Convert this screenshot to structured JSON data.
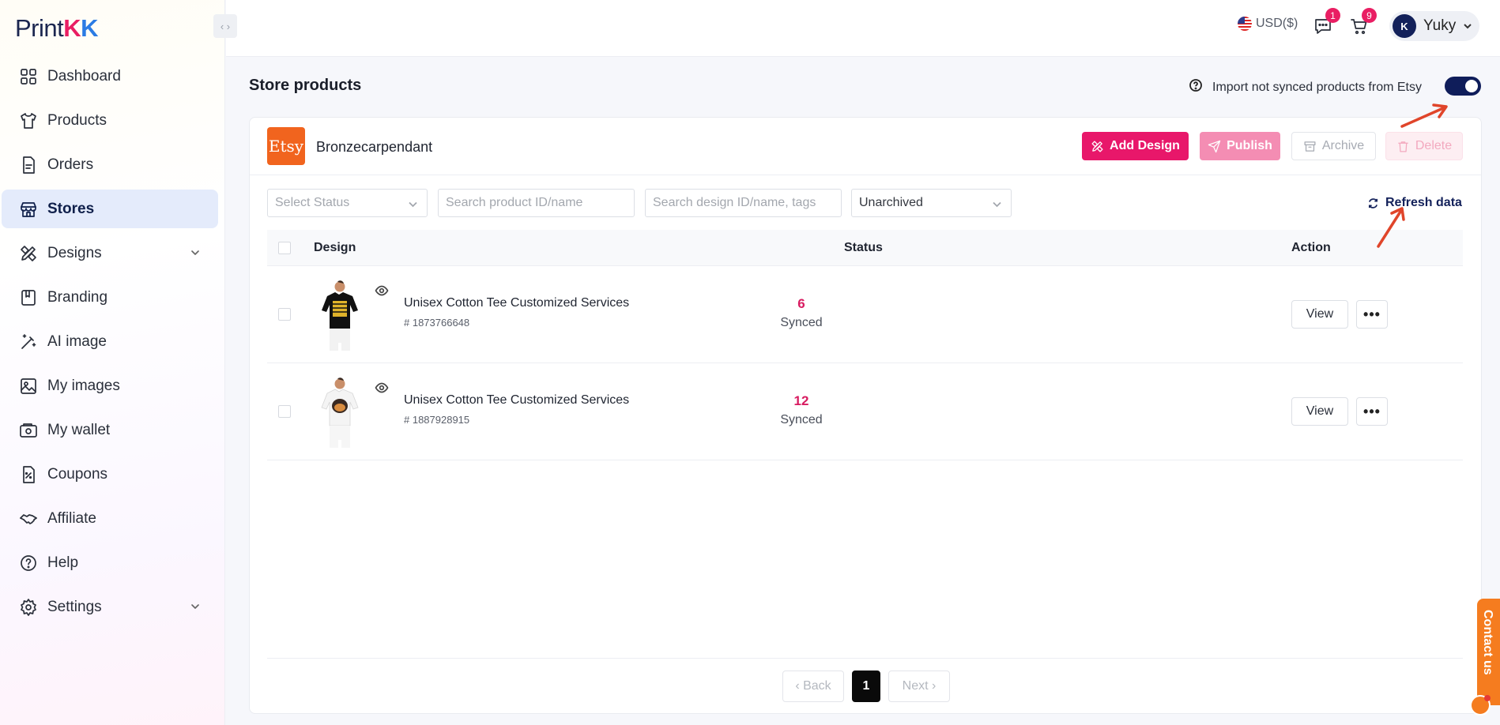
{
  "brand": {
    "prefix": "Print",
    "k1": "K",
    "k2": "K",
    "collapse": "‹ ›"
  },
  "sidebar": {
    "items": [
      {
        "label": "Dashboard",
        "icon": "grid-icon"
      },
      {
        "label": "Products",
        "icon": "tshirt-icon"
      },
      {
        "label": "Orders",
        "icon": "document-icon"
      },
      {
        "label": "Stores",
        "icon": "store-icon"
      },
      {
        "label": "Designs",
        "icon": "pencil-ruler-icon"
      },
      {
        "label": "Branding",
        "icon": "book-icon"
      },
      {
        "label": "AI image",
        "icon": "magic-wand-icon"
      },
      {
        "label": "My images",
        "icon": "image-icon"
      },
      {
        "label": "My wallet",
        "icon": "wallet-icon"
      },
      {
        "label": "Coupons",
        "icon": "coupon-icon"
      },
      {
        "label": "Affiliate",
        "icon": "handshake-icon"
      },
      {
        "label": "Help",
        "icon": "help-circle-icon"
      },
      {
        "label": "Settings",
        "icon": "gear-icon"
      }
    ],
    "active": "Stores"
  },
  "topbar": {
    "currency": "USD($)",
    "messages_count": "1",
    "cart_count": "9",
    "user": {
      "initials": "K",
      "name": "Yuky"
    }
  },
  "page": {
    "title": "Store products",
    "import_label": "Import not synced products from Etsy",
    "import_enabled": true
  },
  "store": {
    "logo_text": "Etsy",
    "name": "Bronzecarpendant",
    "logo_color": "#f1641e"
  },
  "actions": {
    "add_design": "Add Design",
    "publish": "Publish",
    "archive": "Archive",
    "delete": "Delete"
  },
  "filters": {
    "status_placeholder": "Select Status",
    "product_placeholder": "Search product ID/name",
    "design_placeholder": "Search design ID/name, tags",
    "archive_value": "Unarchived",
    "refresh": "Refresh data"
  },
  "table": {
    "headers": {
      "design": "Design",
      "status": "Status",
      "action": "Action"
    },
    "rows": [
      {
        "name": "Unisex Cotton Tee Customized Services",
        "id": "# 1873766648",
        "count": "6",
        "status": "Synced",
        "view": "View",
        "shirt": "black"
      },
      {
        "name": "Unisex Cotton Tee Customized Services",
        "id": "# 1887928915",
        "count": "12",
        "status": "Synced",
        "view": "View",
        "shirt": "white"
      }
    ]
  },
  "pagination": {
    "back": "Back",
    "current": "1",
    "next": "Next"
  },
  "contact": {
    "label": "Contact us"
  },
  "colors": {
    "accent": "#e8176a",
    "navy": "#0f1d5a",
    "annotation": "#e0452a"
  }
}
